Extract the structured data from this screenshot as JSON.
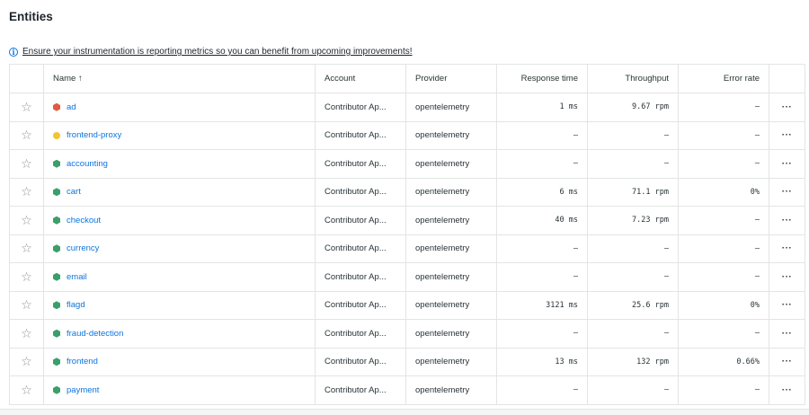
{
  "page": {
    "title": "Entities"
  },
  "notice": {
    "text": "Ensure your instrumentation is reporting metrics so you can benefit from upcoming improvements!"
  },
  "table": {
    "columns": {
      "name": "Name ↑",
      "account": "Account",
      "provider": "Provider",
      "response_time": "Response time",
      "throughput": "Throughput",
      "error_rate": "Error rate"
    },
    "rows": [
      {
        "name": "ad",
        "status": "critical",
        "status_color": "#df5c44",
        "status_shape": "hex",
        "account": "Contributor Ap...",
        "provider": "opentelemetry",
        "response_time": "1 ms",
        "throughput": "9.67 rpm",
        "error_rate": "–"
      },
      {
        "name": "frontend-proxy",
        "status": "warning",
        "status_color": "#f2c433",
        "status_shape": "circle",
        "account": "Contributor Ap...",
        "provider": "opentelemetry",
        "response_time": "–",
        "throughput": "–",
        "error_rate": "–"
      },
      {
        "name": "accounting",
        "status": "healthy",
        "status_color": "#3a9f6a",
        "status_shape": "hex",
        "account": "Contributor Ap...",
        "provider": "opentelemetry",
        "response_time": "–",
        "throughput": "–",
        "error_rate": "–"
      },
      {
        "name": "cart",
        "status": "healthy",
        "status_color": "#3a9f6a",
        "status_shape": "hex",
        "account": "Contributor Ap...",
        "provider": "opentelemetry",
        "response_time": "6 ms",
        "throughput": "71.1 rpm",
        "error_rate": "0%"
      },
      {
        "name": "checkout",
        "status": "healthy",
        "status_color": "#3a9f6a",
        "status_shape": "hex",
        "account": "Contributor Ap...",
        "provider": "opentelemetry",
        "response_time": "40 ms",
        "throughput": "7.23 rpm",
        "error_rate": "–"
      },
      {
        "name": "currency",
        "status": "healthy",
        "status_color": "#3a9f6a",
        "status_shape": "hex",
        "account": "Contributor Ap...",
        "provider": "opentelemetry",
        "response_time": "–",
        "throughput": "–",
        "error_rate": "–"
      },
      {
        "name": "email",
        "status": "healthy",
        "status_color": "#3a9f6a",
        "status_shape": "hex",
        "account": "Contributor Ap...",
        "provider": "opentelemetry",
        "response_time": "–",
        "throughput": "–",
        "error_rate": "–"
      },
      {
        "name": "flagd",
        "status": "healthy",
        "status_color": "#3a9f6a",
        "status_shape": "hex",
        "account": "Contributor Ap...",
        "provider": "opentelemetry",
        "response_time": "3121 ms",
        "throughput": "25.6 rpm",
        "error_rate": "0%"
      },
      {
        "name": "fraud-detection",
        "status": "healthy",
        "status_color": "#3a9f6a",
        "status_shape": "hex",
        "account": "Contributor Ap...",
        "provider": "opentelemetry",
        "response_time": "–",
        "throughput": "–",
        "error_rate": "–"
      },
      {
        "name": "frontend",
        "status": "healthy",
        "status_color": "#3a9f6a",
        "status_shape": "hex",
        "account": "Contributor Ap...",
        "provider": "opentelemetry",
        "response_time": "13 ms",
        "throughput": "132 rpm",
        "error_rate": "0.66%"
      },
      {
        "name": "payment",
        "status": "healthy",
        "status_color": "#3a9f6a",
        "status_shape": "hex",
        "account": "Contributor Ap...",
        "provider": "opentelemetry",
        "response_time": "–",
        "throughput": "–",
        "error_rate": "–"
      }
    ],
    "star_icon": "star-outline-icon",
    "menu_icon": "ellipsis-icon",
    "menu_glyph": "···"
  }
}
